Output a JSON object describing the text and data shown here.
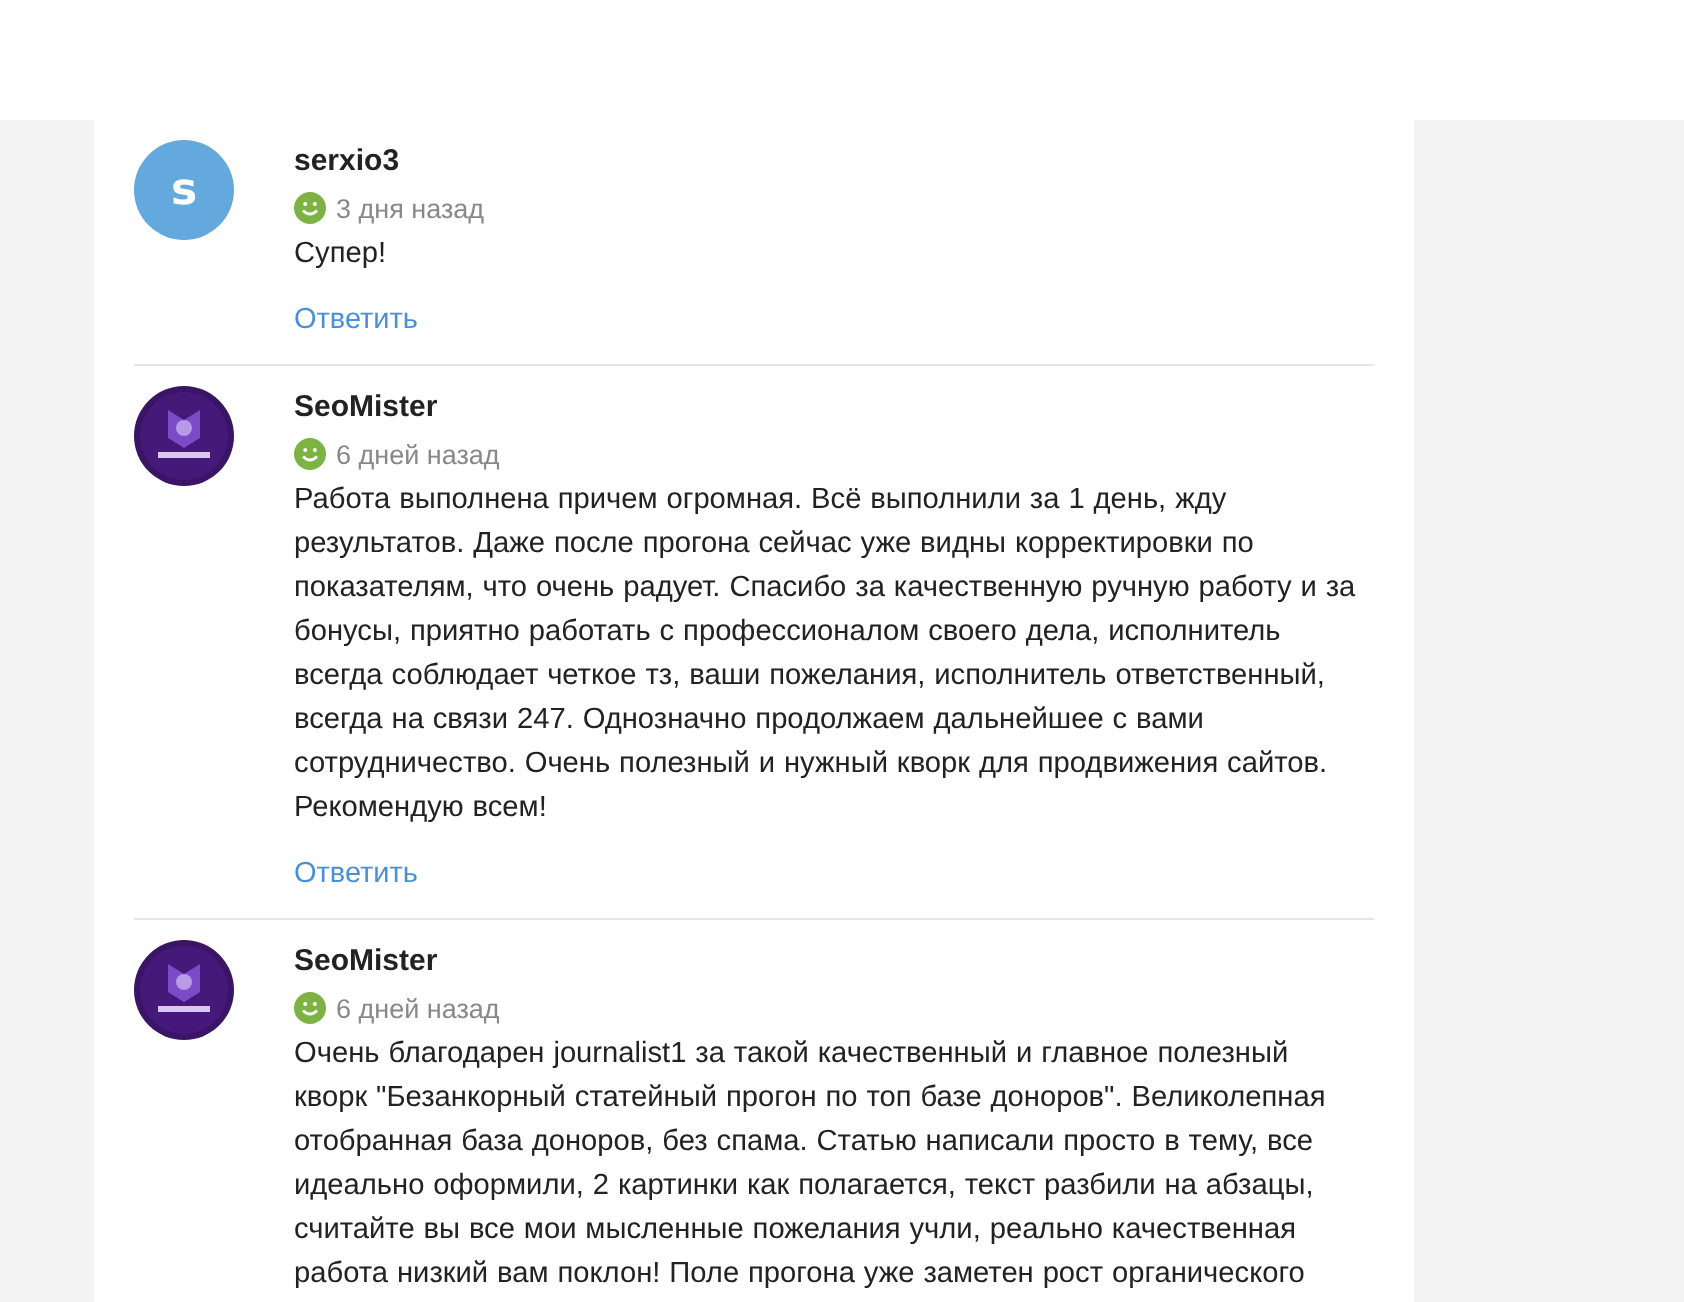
{
  "reviews": [
    {
      "author": "serxio3",
      "avatar": {
        "kind": "letter",
        "letter": "s",
        "color": "#64a9de"
      },
      "time": "3 дня назад",
      "text": "Супер!",
      "reply": "Ответить"
    },
    {
      "author": "SeoMister",
      "time": "6 дней назад",
      "text": "Работа выполнена причем огромная. Всё выполнили за 1 день, жду результатов. Даже после прогона сейчас уже видны корректировки по показателям, что очень радует. Спасибо за качественную ручную работу и за бонусы, приятно работать с профессионалом своего дела, исполнитель всегда соблюдает четкое тз, ваши пожелания, исполнитель ответственный, всегда на связи 247.  Однозначно продолжаем дальнейшее с вами сотрудничество. Очень полезный и нужный кворк для продвижения сайтов. Рекомендую всем!",
      "reply": "Ответить"
    },
    {
      "author": "SeoMister",
      "time": "6 дней назад",
      "text": "Очень благодарен journalist1 за такой качественный и главное полезный кворк \"Безанкорный статейный прогон по топ базе доноров\". Великолепная отобранная база доноров, без спама. Статью написали просто в тему, все идеально оформили, 2 картинки как полагается, текст разбили на абзацы, считайте вы все мои мысленные пожелания учли, реально качественная работа низкий вам поклон! Поле прогона уже заметен рост органического"
    }
  ]
}
